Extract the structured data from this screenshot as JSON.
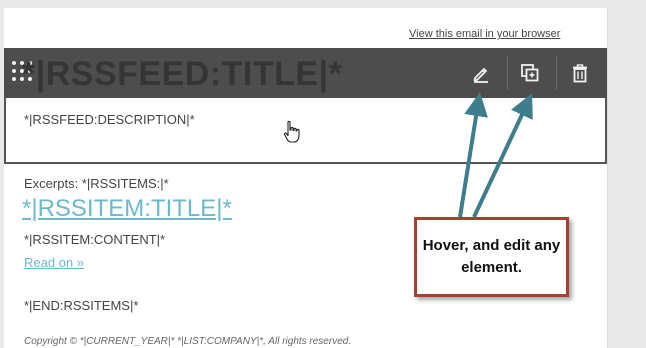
{
  "header": {
    "view_in_browser": "View this email in your browser"
  },
  "toolbar": {
    "drag_icon": "drag-handle-icon",
    "edit_icon": "pencil-icon",
    "duplicate_icon": "duplicate-icon",
    "delete_icon": "trash-icon"
  },
  "content": {
    "feed_title": "*|RSSFEED:TITLE|*",
    "feed_description": "*|RSSFEED:DESCRIPTION|*",
    "excerpts": "Excerpts: *|RSSITEMS:|*",
    "item_title": "*|RSSITEM:TITLE|*",
    "item_content": "*|RSSITEM:CONTENT|*",
    "read_on": "Read on »",
    "end_items": "*|END:RSSITEMS|*",
    "copyright": "Copyright © *|CURRENT_YEAR|* *|LIST:COMPANY|*, All rights reserved."
  },
  "callout": {
    "text": "Hover, and edit any element."
  },
  "colors": {
    "toolbar_bg": "#4d4d4d",
    "link": "#6bb9d1",
    "arrow": "#3e7d8c",
    "callout_border": "#a4402e"
  }
}
